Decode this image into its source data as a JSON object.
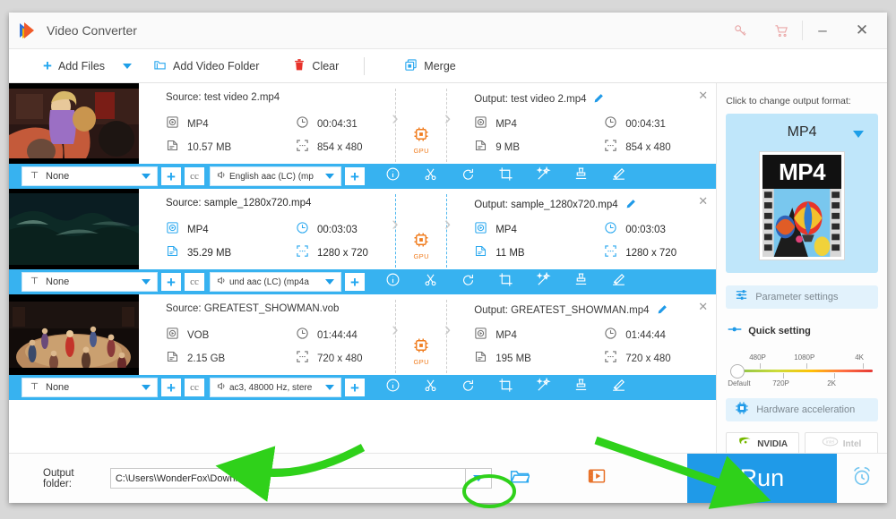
{
  "window": {
    "title": "Video Converter",
    "logo_icon": "wonderfox-logo-icon",
    "key_icon": "key-icon",
    "cart_icon": "cart-icon",
    "minimize_label": "–",
    "close_label": "✕"
  },
  "menubar": {
    "add_files": {
      "label": "Add Files",
      "icon": "plus-icon"
    },
    "dropdown_icon": "chevron-down-icon",
    "add_video_folder": {
      "label": "Add Video Folder",
      "icon": "folder-icon"
    },
    "clear": {
      "label": "Clear",
      "icon": "trash-icon"
    },
    "merge": {
      "label": "Merge",
      "icon": "merge-icon"
    }
  },
  "files": [
    {
      "selected": false,
      "thumbnail": "video-thumbnail-friends",
      "source": {
        "prefix": "Source:",
        "name": "test video 2.mp4",
        "format": "MP4",
        "duration": "00:04:31",
        "size": "10.57 MB",
        "resolution": "854 x 480"
      },
      "gpu_badge": "GPU",
      "output": {
        "prefix": "Output:",
        "name": "test video 2.mp4",
        "format": "MP4",
        "duration": "00:04:31",
        "size": "9 MB",
        "resolution": "854 x 480",
        "edit_icon": "pencil-icon"
      },
      "remove_icon": "close-icon",
      "toolbar": {
        "subtitle_value": "None",
        "subtitle_icon": "text-icon",
        "add_subtitle_icon": "plus-icon",
        "cc_icon": "cc-icon",
        "audio_value": "English aac (LC) (mp",
        "audio_icon": "speaker-icon",
        "add_audio_icon": "plus-icon",
        "tools": [
          "info-icon",
          "cut-icon",
          "rotate-icon",
          "crop-icon",
          "effects-icon",
          "watermark-icon",
          "subtitle-edit-icon"
        ]
      }
    },
    {
      "selected": true,
      "thumbnail": "video-thumbnail-ocean",
      "source": {
        "prefix": "Source:",
        "name": "sample_1280x720.mp4",
        "format": "MP4",
        "duration": "00:03:03",
        "size": "35.29 MB",
        "resolution": "1280 x 720"
      },
      "gpu_badge": "GPU",
      "output": {
        "prefix": "Output:",
        "name": "sample_1280x720.mp4",
        "format": "MP4",
        "duration": "00:03:03",
        "size": "11 MB",
        "resolution": "1280 x 720",
        "edit_icon": "pencil-icon"
      },
      "remove_icon": "close-icon",
      "toolbar": {
        "subtitle_value": "None",
        "subtitle_icon": "text-icon",
        "add_subtitle_icon": "plus-icon",
        "cc_icon": "cc-icon",
        "audio_value": "und aac (LC) (mp4a",
        "audio_icon": "speaker-icon",
        "add_audio_icon": "plus-icon",
        "tools": [
          "info-icon",
          "cut-icon",
          "rotate-icon",
          "crop-icon",
          "effects-icon",
          "watermark-icon",
          "subtitle-edit-icon"
        ]
      }
    },
    {
      "selected": false,
      "thumbnail": "video-thumbnail-circus",
      "source": {
        "prefix": "Source:",
        "name": "GREATEST_SHOWMAN.vob",
        "format": "VOB",
        "duration": "01:44:44",
        "size": "2.15 GB",
        "resolution": "720 x 480"
      },
      "gpu_badge": "GPU",
      "output": {
        "prefix": "Output:",
        "name": "GREATEST_SHOWMAN.mp4",
        "format": "MP4",
        "duration": "01:44:44",
        "size": "195 MB",
        "resolution": "720 x 480",
        "edit_icon": "pencil-icon"
      },
      "remove_icon": "close-icon",
      "toolbar": {
        "subtitle_value": "None",
        "subtitle_icon": "text-icon",
        "add_subtitle_icon": "plus-icon",
        "cc_icon": "cc-icon",
        "audio_value": "ac3, 48000 Hz, stere",
        "audio_icon": "speaker-icon",
        "add_audio_icon": "plus-icon",
        "tools": [
          "info-icon",
          "cut-icon",
          "rotate-icon",
          "crop-icon",
          "effects-icon",
          "watermark-icon",
          "subtitle-edit-icon"
        ]
      }
    }
  ],
  "right_panel": {
    "hint": "Click to change output format:",
    "format_name": "MP4",
    "format_dropdown_icon": "chevron-down-icon",
    "format_thumb_label": "MP4",
    "parameter_settings": {
      "label": "Parameter settings",
      "icon": "sliders-icon"
    },
    "quick_setting": {
      "label": "Quick setting",
      "icon": "quick-setting-icon"
    },
    "slider": {
      "value_label": "Default",
      "top_ticks": [
        "480P",
        "1080P",
        "4K"
      ],
      "bottom_ticks": [
        "Default",
        "720P",
        "2K"
      ]
    },
    "hardware_acceleration": {
      "label": "Hardware acceleration",
      "icon": "chip-icon"
    },
    "gpu_options": [
      {
        "name": "NVIDIA",
        "icon": "nvidia-icon",
        "enabled": true
      },
      {
        "name": "Intel",
        "icon": "intel-icon",
        "enabled": false
      }
    ]
  },
  "bottom": {
    "output_folder_label": "Output folder:",
    "output_folder_path": "C:\\Users\\WonderFox\\Downloads",
    "path_dropdown_icon": "chevron-down-icon",
    "open_folder_icon": "folder-open-icon",
    "video_library_icon": "video-library-icon",
    "run_label": "Run",
    "timer_icon": "alarm-clock-icon"
  },
  "colors": {
    "accent_blue": "#1f9ae8",
    "bar_blue": "#37b2f0",
    "gpu_orange": "#f07c1e",
    "annotation_green": "#2fd11a",
    "format_panel": "#bfe6fa"
  },
  "annotations": {
    "arrow_to_path_dropdown": "green-arrow",
    "circle_on_path_dropdown": "green-ellipse",
    "arrow_to_run": "green-arrow"
  }
}
